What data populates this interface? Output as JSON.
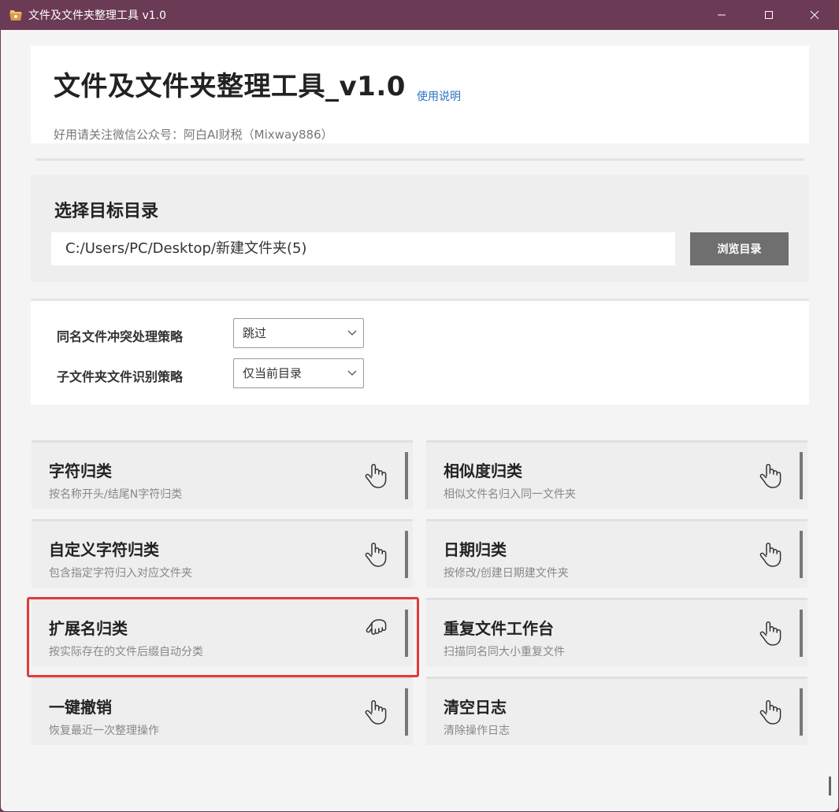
{
  "window": {
    "title": "文件及文件夹整理工具 v1.0",
    "app_icon": "folder-icon"
  },
  "header": {
    "title": "文件及文件夹整理工具_v1.0",
    "usage_link": "使用说明",
    "subtitle": "好用请关注微信公众号：阿白AI财税（Mixway886）"
  },
  "directory": {
    "heading": "选择目标目录",
    "path_value": "C:/Users/PC/Desktop/新建文件夹(5)",
    "browse_label": "浏览目录"
  },
  "options": {
    "conflict_label": "同名文件冲突处理策略",
    "conflict_value": "跳过",
    "subfolder_label": "子文件夹文件识别策略",
    "subfolder_value": "仅当前目录"
  },
  "functions": [
    {
      "title": "字符归类",
      "desc": "按名称开头/结尾N字符归类",
      "icon": "pointing-hand-icon"
    },
    {
      "title": "相似度归类",
      "desc": "相似文件名归入同一文件夹",
      "icon": "pointing-hand-icon"
    },
    {
      "title": "自定义字符归类",
      "desc": "包含指定字符归入对应文件夹",
      "icon": "pointing-hand-icon"
    },
    {
      "title": "日期归类",
      "desc": "按修改/创建日期建文件夹",
      "icon": "pointing-hand-icon"
    },
    {
      "title": "扩展名归类",
      "desc": "按实际存在的文件后缀自动分类",
      "icon": "pointing-hand-down-icon"
    },
    {
      "title": "重复文件工作台",
      "desc": "扫描同名同大小重复文件",
      "icon": "pointing-hand-icon"
    },
    {
      "title": "一键撤销",
      "desc": "恢复最近一次整理操作",
      "icon": "pointing-hand-icon"
    },
    {
      "title": "清空日志",
      "desc": "清除操作日志",
      "icon": "pointing-hand-icon"
    }
  ],
  "colors": {
    "titlebar": "#6b3a55",
    "highlight": "#e23b3b",
    "link": "#2b71c6",
    "button": "#6f6f6f"
  }
}
